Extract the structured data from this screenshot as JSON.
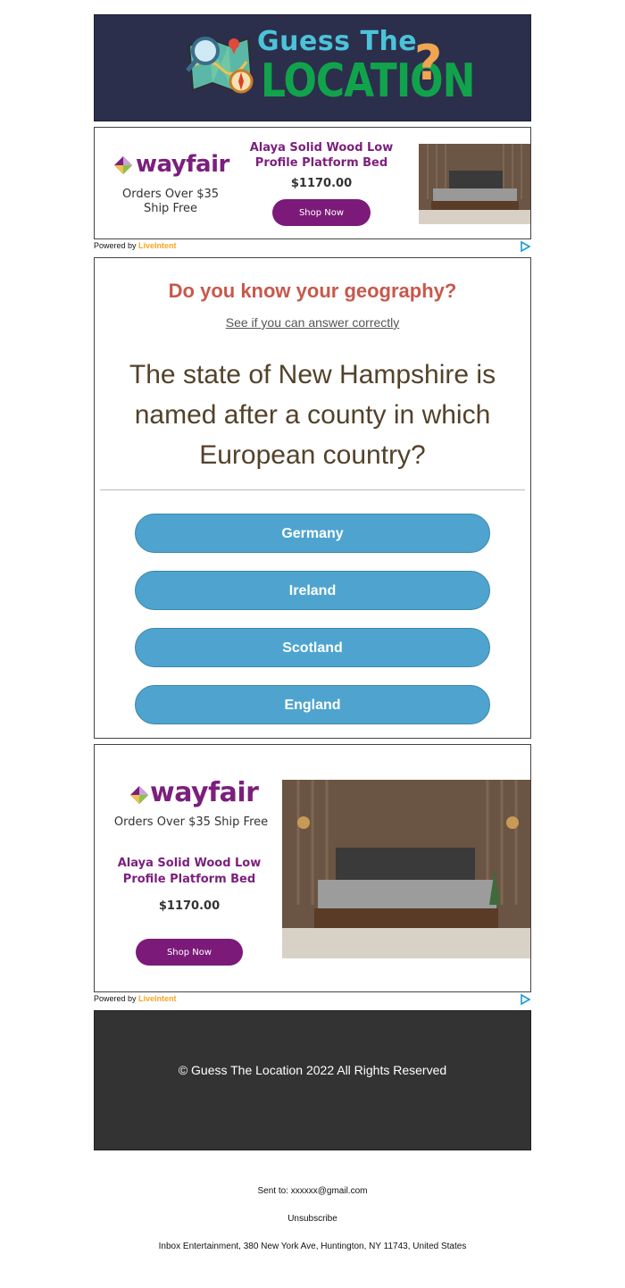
{
  "header": {
    "logo_line1": "Guess The",
    "logo_line2": "LOCATION",
    "logo_mark": "?"
  },
  "ad_top": {
    "brand": "wayfair",
    "caption": "Orders Over $35 Ship Free",
    "product": "Alaya Solid Wood Low Profile Platform Bed",
    "price": "$1170.00",
    "cta": "Shop Now",
    "powered_by": "Powered by",
    "powered_brand": "LiveIntent"
  },
  "quiz": {
    "title": "Do you know your geography?",
    "subtitle": "See if you can answer correctly",
    "question": "The state of New Hampshire is named after a county in which European country?",
    "answers": [
      "Germany",
      "Ireland",
      "Scotland",
      "England"
    ]
  },
  "ad_bottom": {
    "brand": "wayfair",
    "caption": "Orders Over $35 Ship Free",
    "product": "Alaya Solid Wood Low Profile Platform Bed",
    "price": "$1170.00",
    "cta": "Shop Now",
    "powered_by": "Powered by",
    "powered_brand": "LiveIntent"
  },
  "footer": {
    "copyright": "© Guess The Location 2022 All Rights Reserved",
    "sent_to": "Sent to: xxxxxx@gmail.com",
    "unsubscribe": "Unsubscribe",
    "address": "Inbox Entertainment, 380 New York Ave, Huntington, NY 11743, United States"
  },
  "colors": {
    "header_bg": "#2b2f4c",
    "quiz_title": "#c8584b",
    "answer_button": "#4ea4cf",
    "brand_purple": "#7b1f7d",
    "footer_bg": "#333333"
  }
}
